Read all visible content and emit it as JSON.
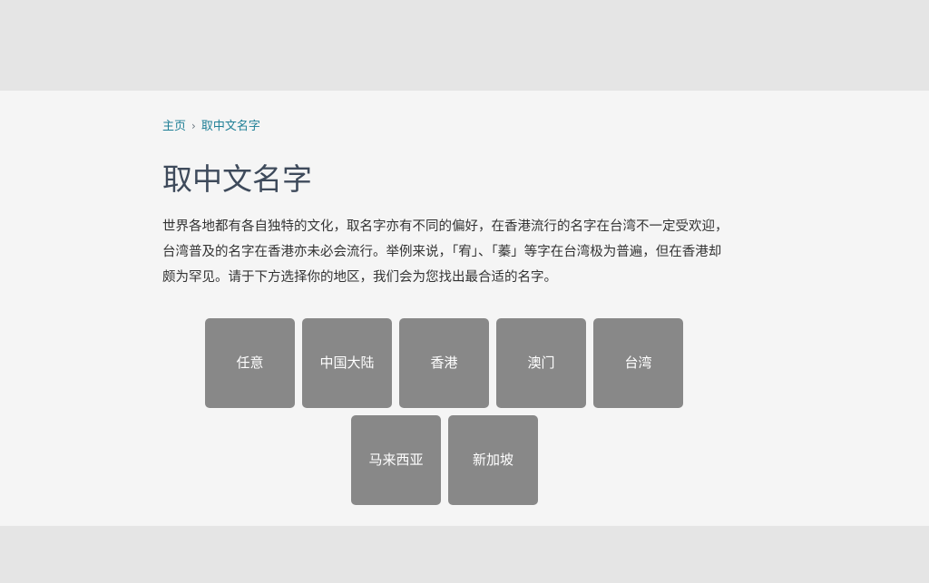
{
  "breadcrumb": {
    "home": "主页",
    "separator": "›",
    "current": "取中文名字"
  },
  "page": {
    "title": "取中文名字",
    "intro": "世界各地都有各自独特的文化，取名字亦有不同的偏好，在香港流行的名字在台湾不一定受欢迎，台湾普及的名字在香港亦未必会流行。举例来说，「宥」、「蓁」等字在台湾极为普遍，但在香港却颇为罕见。请于下方选择你的地区，我们会为您找出最合适的名字。"
  },
  "regions": {
    "any": "任意",
    "mainland": "中国大陆",
    "hongkong": "香港",
    "macau": "澳门",
    "taiwan": "台湾",
    "malaysia": "马来西亚",
    "singapore": "新加坡"
  },
  "colors": {
    "background": "#e5e5e5",
    "panel": "#f5f5f5",
    "link": "#1f7f96",
    "title": "#3e4a5b",
    "text": "#333333",
    "button_bg": "#888888",
    "button_text": "#ffffff"
  }
}
